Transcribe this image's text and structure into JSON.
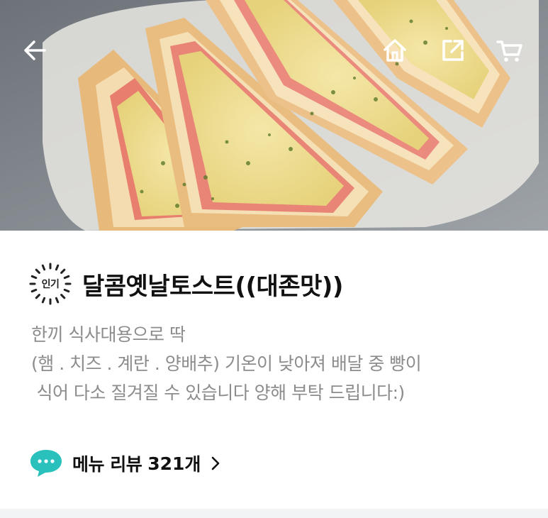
{
  "hero": {
    "description": "sandwich-photo"
  },
  "topbar": {
    "back_icon": "arrow-left-icon",
    "home_icon": "home-icon",
    "share_icon": "share-icon",
    "cart_icon": "cart-icon"
  },
  "menu": {
    "badge_label": "인기",
    "title": "달콤옛날토스트((대존맛))",
    "description_lines": [
      "한끼 식사대용으로 딱",
      "(햄 . 치즈 . 계란 . 양배추) 기온이 낮아져 배달 중 빵이",
      " 식어 다소 질겨질 수 있습니다 양해 부탁 드립니다:)"
    ]
  },
  "reviews": {
    "label": "메뉴 리뷰",
    "count": "321",
    "unit": "개",
    "icon": "chat-bubble-icon",
    "accent_color": "#2ac1bc"
  }
}
